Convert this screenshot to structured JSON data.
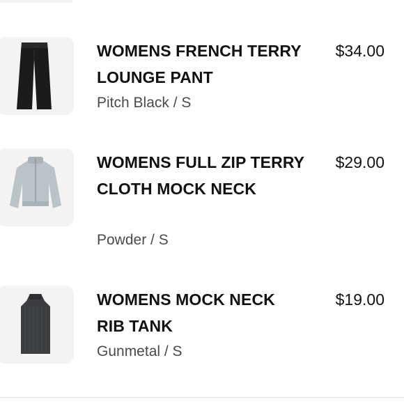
{
  "cart": {
    "items": [
      {
        "name": "WOMENS FRENCH TERRY LOUNGE PANT",
        "variant": "Pitch Black / S",
        "price": "$34.00",
        "image_icon": "black-lounge-pant-icon"
      },
      {
        "name": "WOMENS FULL ZIP TERRY CLOTH MOCK NECK",
        "variant": "Powder / S",
        "price": "$29.00",
        "image_icon": "powder-full-zip-jacket-icon"
      },
      {
        "name": "WOMENS MOCK NECK RIB TANK",
        "variant": "Gunmetal / S",
        "price": "$19.00",
        "image_icon": "gunmetal-rib-tank-icon"
      }
    ]
  },
  "colors": {
    "text": "#111111",
    "muted": "#4a4a4a",
    "thumb_bg": "#f3f3f3",
    "divider": "#e3e3e3"
  }
}
